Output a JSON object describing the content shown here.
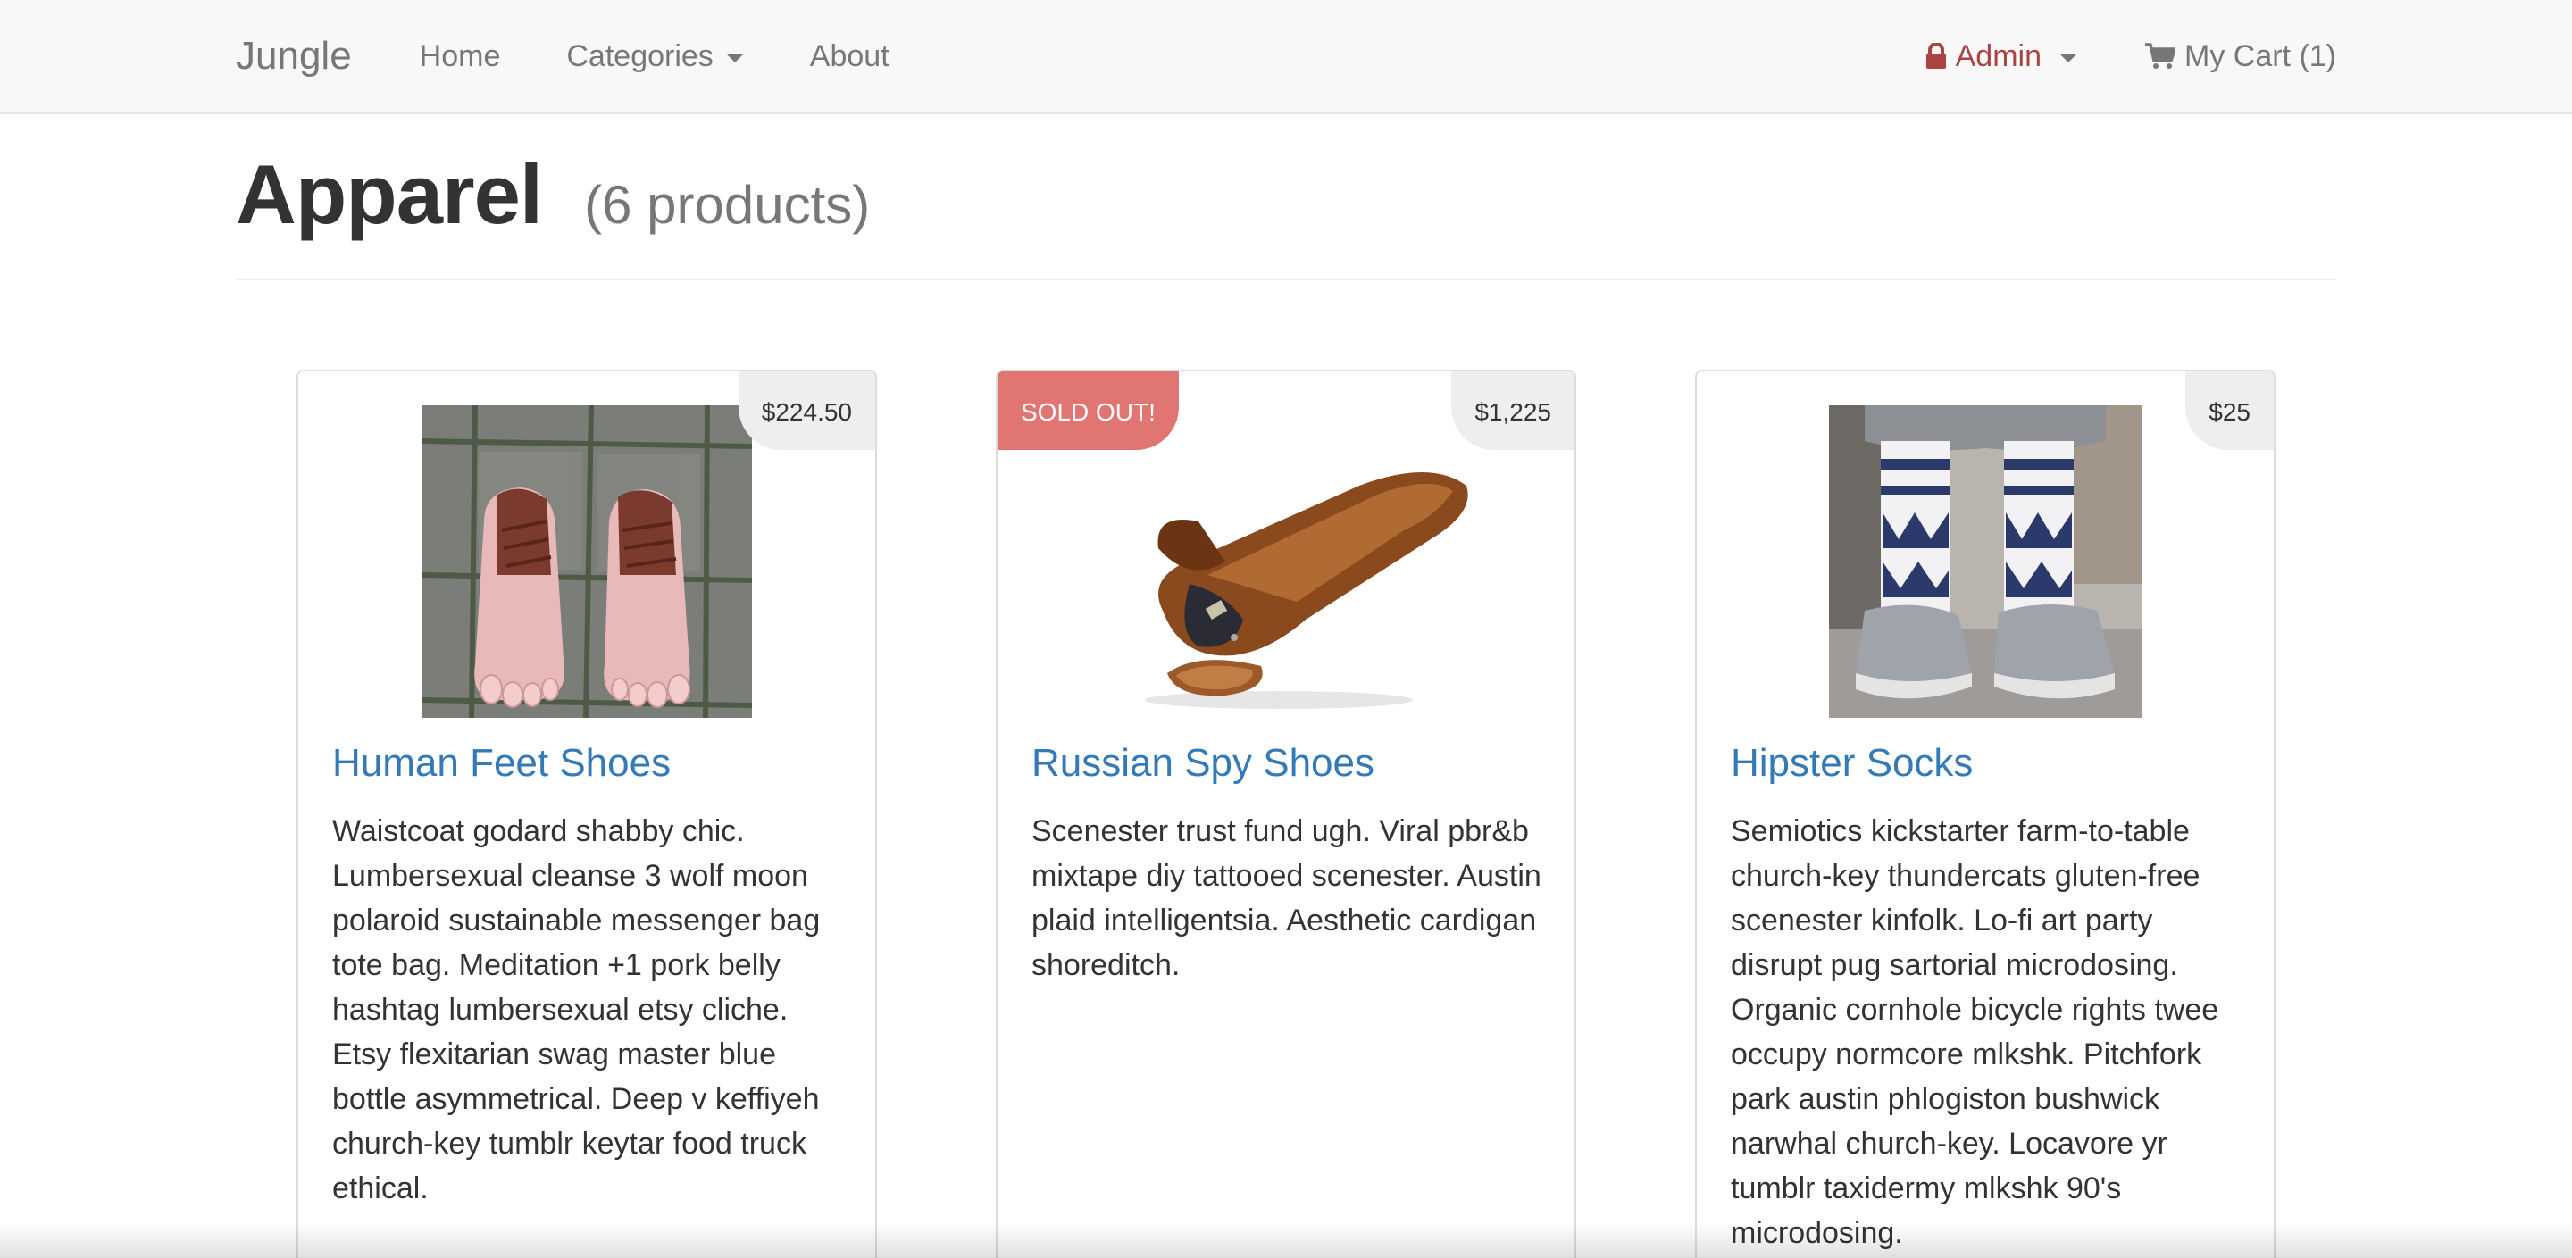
{
  "navbar": {
    "brand": "Jungle",
    "links": [
      {
        "label": "Home"
      },
      {
        "label": "Categories"
      },
      {
        "label": "About"
      }
    ],
    "admin_label": "Admin",
    "cart_label": "My Cart (1)"
  },
  "page": {
    "title": "Apparel",
    "count": "(6 products)"
  },
  "products": [
    {
      "name": "Human Feet Shoes",
      "price": "$224.50",
      "sold_out": "",
      "description": "Waistcoat godard shabby chic. Lumbersexual cleanse 3 wolf moon polaroid sustainable messenger bag tote bag. Meditation +1 pork belly hashtag lumbersexual etsy cliche. Etsy flexitarian swag master blue bottle asymmetrical. Deep v keffiyeh church-key tumblr keytar food truck ethical."
    },
    {
      "name": "Russian Spy Shoes",
      "price": "$1,225",
      "sold_out": "SOLD OUT!",
      "description": "Scenester trust fund ugh. Viral pbr&b mixtape diy tattooed scenester. Austin plaid intelligentsia. Aesthetic cardigan shoreditch."
    },
    {
      "name": "Hipster Socks",
      "price": "$25",
      "sold_out": "",
      "description": "Semiotics kickstarter farm-to-table church-key thundercats gluten-free scenester kinfolk. Lo-fi art party disrupt pug sartorial microdosing. Organic cornhole bicycle rights twee occupy normcore mlkshk. Pitchfork park austin phlogiston bushwick narwhal church-key. Locavore yr tumblr taxidermy mlkshk 90's microdosing."
    }
  ],
  "colors": {
    "link": "#337ab7",
    "admin": "#a94442",
    "sold_out": "#d9534f",
    "navbar_bg": "#f8f8f8"
  },
  "icons": [
    "lock-icon",
    "shopping-cart-icon",
    "caret-down-icon"
  ]
}
